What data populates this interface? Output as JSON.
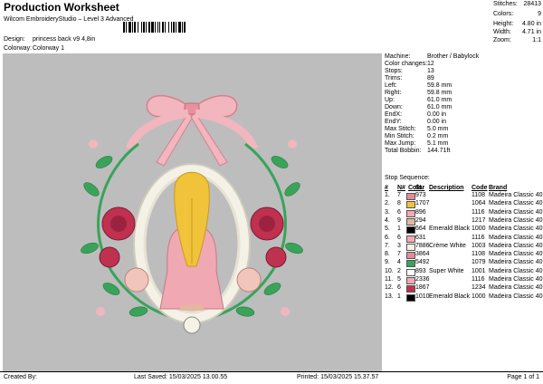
{
  "header": {
    "title": "Production Worksheet",
    "subtitle": "Wilcom EmbroideryStudio – Level 3 Advanced",
    "barcode_icon": "barcode-icon",
    "design_label": "Design:",
    "design_value": "princess back v9 4,8in",
    "colorway_label": "Colorway:",
    "colorway_value": "Colorway 1"
  },
  "stats": [
    {
      "label": "Stitches:",
      "value": "28413"
    },
    {
      "label": "Colors:",
      "value": "9"
    },
    {
      "label": "Height:",
      "value": "4.80 in"
    },
    {
      "label": "Width:",
      "value": "4.71 in"
    },
    {
      "label": "Zoom:",
      "value": "1:1"
    }
  ],
  "info": [
    {
      "label": "Machine:",
      "value": "Brother / Babylock"
    },
    {
      "label": "Color changes:",
      "value": "12"
    },
    {
      "label": "Stops:",
      "value": "13"
    },
    {
      "label": "Trims:",
      "value": "89"
    },
    {
      "label": "Left:",
      "value": "59.8 mm"
    },
    {
      "label": "Right:",
      "value": "59.8 mm"
    },
    {
      "label": "Up:",
      "value": "61.0 mm"
    },
    {
      "label": "Down:",
      "value": "61.0 mm"
    },
    {
      "label": "EndX:",
      "value": "0.00 in"
    },
    {
      "label": "EndY:",
      "value": "0.00 in"
    },
    {
      "label": "Max Stitch:",
      "value": "5.0 mm"
    },
    {
      "label": "Min Stitch:",
      "value": "0.2 mm"
    },
    {
      "label": "Max Jump:",
      "value": "5.1 mm"
    },
    {
      "label": "Total Bobbin:",
      "value": "144.71ft"
    }
  ],
  "stop_sequence": {
    "title": "Stop Sequence:",
    "headers": {
      "num": "#",
      "n": "N#",
      "color": "Color",
      "st": "St.",
      "desc": "Description",
      "code": "Code",
      "brand": "Brand"
    },
    "rows": [
      {
        "num": "1.",
        "n": "7",
        "color": "#e48a9a",
        "st": "973",
        "desc": "",
        "code": "1108",
        "brand": "Madeira Classic 40"
      },
      {
        "num": "2.",
        "n": "8",
        "color": "#f0c33a",
        "st": "1707",
        "desc": "",
        "code": "1064",
        "brand": "Madeira Classic 40"
      },
      {
        "num": "3.",
        "n": "6",
        "color": "#f2a8b5",
        "st": "896",
        "desc": "",
        "code": "1116",
        "brand": "Madeira Classic 40"
      },
      {
        "num": "4.",
        "n": "9",
        "color": "#e3b7a0",
        "st": "294",
        "desc": "",
        "code": "1217",
        "brand": "Madeira Classic 40"
      },
      {
        "num": "5.",
        "n": "1",
        "color": "#000000",
        "st": "664",
        "desc": "Emerald Black",
        "code": "1000",
        "brand": "Madeira Classic 40"
      },
      {
        "num": "6.",
        "n": "6",
        "color": "#f2a8b5",
        "st": "631",
        "desc": "",
        "code": "1116",
        "brand": "Madeira Classic 40"
      },
      {
        "num": "7.",
        "n": "3",
        "color": "#f4f1e6",
        "st": "7886",
        "desc": "Crème White",
        "code": "1003",
        "brand": "Madeira Classic 40"
      },
      {
        "num": "8.",
        "n": "7",
        "color": "#e48a9a",
        "st": "3864",
        "desc": "",
        "code": "1108",
        "brand": "Madeira Classic 40"
      },
      {
        "num": "9.",
        "n": "4",
        "color": "#3aa35a",
        "st": "5492",
        "desc": "",
        "code": "1079",
        "brand": "Madeira Classic 40"
      },
      {
        "num": "10.",
        "n": "2",
        "color": "#ffffff",
        "st": "893",
        "desc": "Super White",
        "code": "1001",
        "brand": "Madeira Classic 40"
      },
      {
        "num": "11.",
        "n": "5",
        "color": "#f2a8b5",
        "st": "2336",
        "desc": "",
        "code": "1116",
        "brand": "Madeira Classic 40"
      },
      {
        "num": "12.",
        "n": "6",
        "color": "#c0314f",
        "st": "1867",
        "desc": "",
        "code": "1234",
        "brand": "Madeira Classic 40"
      },
      {
        "num": "13.",
        "n": "1",
        "color": "#000000",
        "st": "1010",
        "desc": "Emerald Black",
        "code": "1000",
        "brand": "Madeira Classic 40"
      }
    ]
  },
  "footer": {
    "created_by": "Created By:",
    "last_saved": "Last Saved: 15/03/2025 13.00.55",
    "printed": "Printed: 15/03/2025 15.37.57",
    "page": "Page 1 of 1"
  },
  "colors": {
    "canvas_bg": "#bdbdbd",
    "ribbon_pink": "#f0a8b3",
    "rose_red": "#c0314f",
    "leaf_green": "#3aa35a",
    "frame_cream": "#f4f1e6",
    "hair_yellow": "#f0c33a"
  }
}
